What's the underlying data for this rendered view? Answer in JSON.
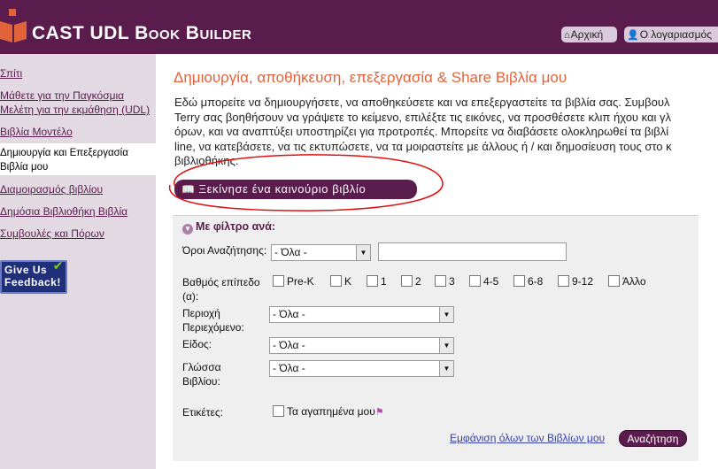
{
  "header": {
    "brand": "CAST UDL",
    "brand_rest": "Book Builder",
    "home_label": "Αρχική",
    "account_label": "Ο λογαριασμός"
  },
  "sidebar": {
    "items": [
      {
        "label": "Σπίτι"
      },
      {
        "label": "Μάθετε για την Παγκόσμια Μελέτη για την εκμάθηση (UDL)"
      },
      {
        "label": "Βιβλία Μοντέλο"
      },
      {
        "label": "Δημιουργία και Επεξεργασία Βιβλία μου",
        "active": true
      },
      {
        "label": "Διαμοιρασμός βιβλίου"
      },
      {
        "label": "Δημόσια Βιβλιοθήκη Βιβλία"
      },
      {
        "label": "Συμβουλές και Πόρων"
      }
    ],
    "feedback": "Give Us Feedback!"
  },
  "main": {
    "title": "Δημιουργία, αποθήκευση, επεξεργασία & Share Βιβλία μου",
    "intro_lines": [
      "Εδώ μπορείτε να δημιουργήσετε, να αποθηκεύσετε και να επεξεργαστείτε τα βιβλία σας. Συμβουλ",
      "Terry σας βοηθήσουν να γράψετε το κείμενο, επιλέξτε τις εικόνες, να προσθέσετε κλιπ ήχου και γλ",
      "όρων, και να αναπτύξει υποστηρίζει για προτροπές. Μπορείτε να διαβάσετε ολοκληρωθεί τα βιβλί",
      "line, να κατεβάσετε, να τις εκτυπώσετε, να τα μοιραστείτε με άλλους ή / και δημοσίευση τους στο κ",
      "βιβλιοθήκης."
    ],
    "start_button": "Ξεκίνησε ένα καινούριο βιβλίο"
  },
  "filter": {
    "title": "Με φίλτρο ανά:",
    "search_terms_label": "Όροι Αναζήτησης:",
    "search_select": "- Όλα -",
    "search_input_value": "",
    "grade_label": "Βαθμός επίπεδο (α):",
    "grades": [
      "Pre-K",
      "K",
      "1",
      "2",
      "3",
      "4-5",
      "6-8",
      "9-12",
      "Άλλο"
    ],
    "content_area_label": "Περιοχή Περιεχόμενο:",
    "content_area_select": "- Όλα -",
    "genre_label": "Είδος:",
    "genre_select": "- Όλα -",
    "language_label": "Γλώσσα Βιβλίου:",
    "language_select": "- Όλα -",
    "tags_label": "Ετικέτες:",
    "favorites_label": "Τα αγαπημένα μου",
    "show_all_link": "Εμφάνιση όλων των Βιβλίων μου",
    "search_button": "Αναζήτηση"
  },
  "colors": {
    "header_bg": "#5a1c4c",
    "sidebar_bg": "#e3d9e3",
    "title_orange": "#e0633a",
    "link_blue": "#3840b0",
    "annotation_red": "#e01010"
  }
}
